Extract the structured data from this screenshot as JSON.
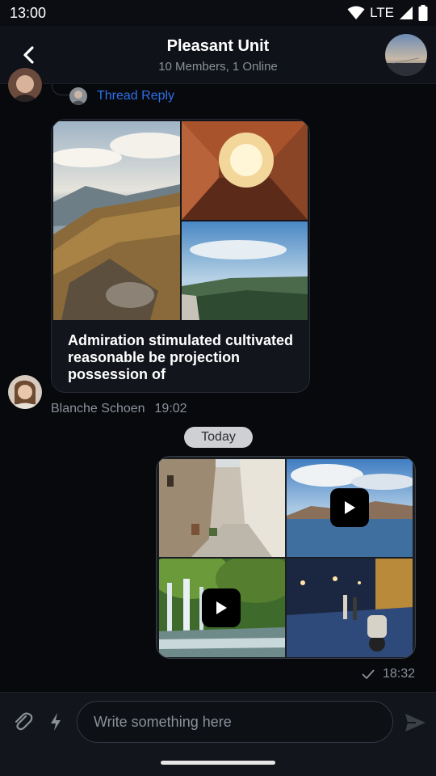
{
  "status_bar": {
    "time": "13:00",
    "network": "LTE"
  },
  "header": {
    "title": "Pleasant Unit",
    "subtitle": "10 Members, 1 Online"
  },
  "thread": {
    "label": "Thread Reply"
  },
  "incoming_message": {
    "text": "Admiration stimulated cultivated reasonable be projection possession of",
    "sender": "Blanche Schoen",
    "time": "19:02",
    "images": [
      "mountain-landscape",
      "building-sky-view",
      "valley-landscape"
    ]
  },
  "date_divider": "Today",
  "outgoing_message": {
    "time": "18:32",
    "media": [
      {
        "type": "image",
        "subject": "old-town-street"
      },
      {
        "type": "video",
        "subject": "lake-mountains"
      },
      {
        "type": "video",
        "subject": "waterfall"
      },
      {
        "type": "image",
        "subject": "night-street-scooter"
      }
    ]
  },
  "composer": {
    "placeholder": "Write something here"
  },
  "colors": {
    "accent": "#2f6fe8",
    "background": "#07090d",
    "bubble": "#12151b"
  }
}
